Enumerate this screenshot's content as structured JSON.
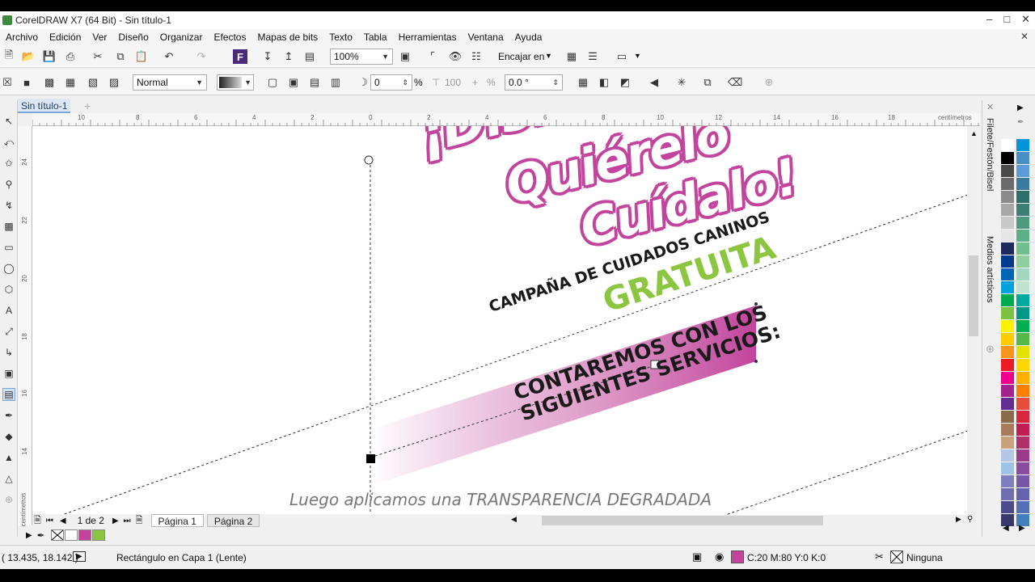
{
  "window": {
    "title": "CorelDRAW X7 (64 Bit) - Sin título-1"
  },
  "menu": [
    "Archivo",
    "Edición",
    "Ver",
    "Diseño",
    "Organizar",
    "Efectos",
    "Mapas de bits",
    "Texto",
    "Tabla",
    "Herramientas",
    "Ventana",
    "Ayuda"
  ],
  "toolbar1": {
    "zoom": "100%",
    "snap_label": "Encajar en"
  },
  "toolbar2": {
    "merge_mode": "Normal",
    "transparency": "0",
    "pct_sign": "%",
    "midpoint": "100",
    "midpoint_pct": "%",
    "angle": "0.0 °"
  },
  "doc_tab": "Sin título-1",
  "ruler": {
    "unit": "centímetros",
    "h_labels": [
      "10",
      "8",
      "6",
      "4",
      "2",
      "0",
      "2",
      "4",
      "6",
      "8",
      "10",
      "12",
      "14",
      "16",
      "18"
    ],
    "v_labels": [
      "24",
      "22",
      "20",
      "18",
      "16",
      "14"
    ],
    "v_unit": "centímetros"
  },
  "artwork": {
    "headline1": "¡Disfrútalo!",
    "headline2": "Quiérelo",
    "headline3": "Cuídalo!",
    "campaign": "CAMPAÑA DE CUIDADOS CANINOS",
    "free": "GRATUITA",
    "banner_line1": "CONTAREMOS CON LOS",
    "banner_line2": "SIGUIENTES SERVICIOS:",
    "caption": "Luego aplicamos una TRANSPARENCIA DEGRADADA",
    "colors": {
      "pink": "#c2449c",
      "green": "#8cc53f",
      "dark": "#1a1a1a"
    }
  },
  "pager": {
    "count": "1 de 2",
    "pages": [
      "Página 1",
      "Página 2"
    ]
  },
  "status": {
    "coords": "( 13.435, 18.142 )",
    "object": "Rectángulo en Capa 1  (Lente)",
    "fill": "C:20 M:80 Y:0 K:0",
    "fill_color": "#c2449c",
    "outline": "Ninguna"
  },
  "dockers": {
    "tab1": "Filete/Festón/Bisel",
    "tab2": "Medios artísticos"
  },
  "palette": [
    "#ffffff",
    "#000000",
    "#4a4a4a",
    "#6b6b6b",
    "#8a8a8a",
    "#a8a8a8",
    "#c8c8c8",
    "#e5e5e5",
    "#1e2a5e",
    "#003b8e",
    "#0066b3",
    "#00a1de",
    "#00aa4f",
    "#7cc142",
    "#fff200",
    "#ffcc00",
    "#f7941d",
    "#ed1c24",
    "#ec008c",
    "#a3238e",
    "#662d91",
    "#8b6b4a",
    "#a87c5b",
    "#c7a27c",
    "#b4c7e7",
    "#9dc3e6",
    "#7f7fbf",
    "#6f6faf",
    "#4c4c8c",
    "#39396b"
  ],
  "palette2": [
    "#0095da",
    "#4a8fc4",
    "#5c9bd3",
    "#3a7a9e",
    "#2e6f6a",
    "#3d7f74",
    "#4f9a7f",
    "#5fae8a",
    "#70bf8f",
    "#8fcf9f",
    "#a3d6c0",
    "#c0e3d0",
    "#00a99d",
    "#009688",
    "#00b050",
    "#55b848",
    "#e4e000",
    "#ffd700",
    "#ffb000",
    "#ff7f00",
    "#e84c3d",
    "#d7263d",
    "#c21e56",
    "#b0306a",
    "#9b3b8c",
    "#8a4ca0",
    "#7758a8",
    "#6563b0",
    "#5471b5",
    "#437fba"
  ],
  "palette_none_title": "none"
}
